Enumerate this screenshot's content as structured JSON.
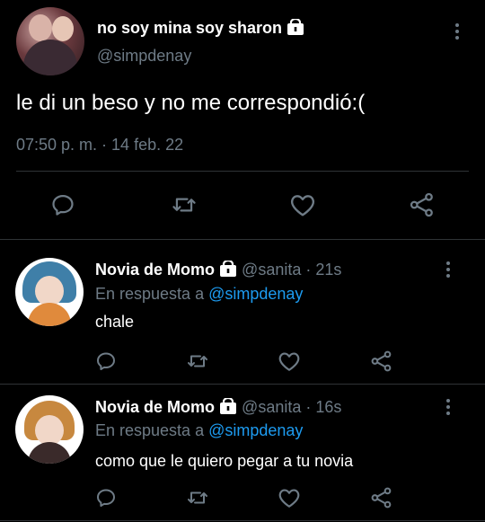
{
  "main_tweet": {
    "display_name": "no soy mina soy sharon",
    "handle": "@simpdenay",
    "text": "le di un beso y no me correspondió:(",
    "timestamp": "07:50 p. m. · 14 feb. 22"
  },
  "replies": [
    {
      "display_name": "Novia de Momo",
      "handle": "@sanita",
      "time": "· 21s",
      "reply_prefix": "En respuesta a",
      "reply_to": "@simpdenay",
      "text": "chale"
    },
    {
      "display_name": "Novia de Momo",
      "handle": "@sanita",
      "time": "· 16s",
      "reply_prefix": "En respuesta a",
      "reply_to": "@simpdenay",
      "text": "como que le quiero pegar a tu novia"
    }
  ],
  "icons": [
    "lock-icon",
    "more-icon",
    "reply-icon",
    "retweet-icon",
    "like-icon",
    "share-icon"
  ],
  "colors": {
    "background": "#000000",
    "muted": "#6e7b86",
    "link": "#1d9bf0",
    "divider": "#2f3336"
  }
}
